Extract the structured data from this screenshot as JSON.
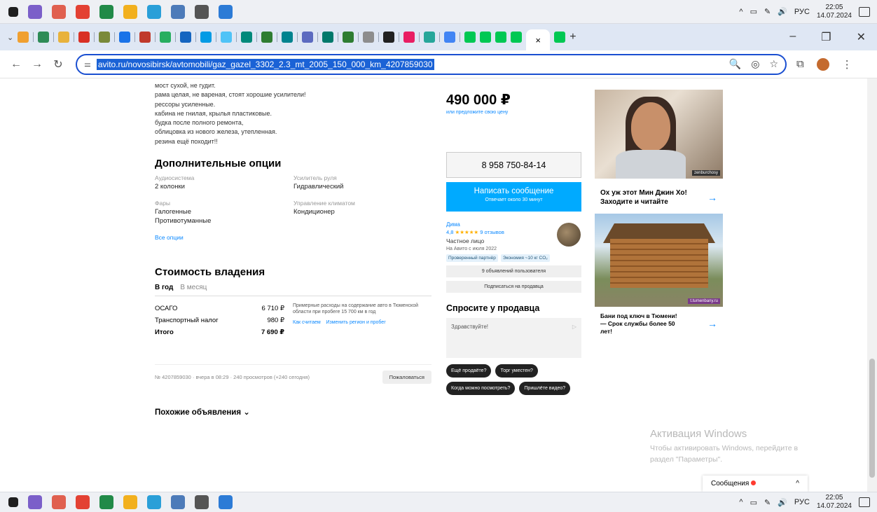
{
  "taskbar": {
    "icons": [
      {
        "name": "start-icon",
        "color": "#1f1f1f"
      },
      {
        "name": "viber-icon",
        "color": "#7b5fc9"
      },
      {
        "name": "paint-icon",
        "color": "#e0604f"
      },
      {
        "name": "chrome-icon",
        "color": "#e34133"
      },
      {
        "name": "excel-icon",
        "color": "#218a48"
      },
      {
        "name": "folder-icon",
        "color": "#f2b01e"
      },
      {
        "name": "telegram-icon",
        "color": "#2a9fd8"
      },
      {
        "name": "notepad-icon",
        "color": "#4d7bb9"
      },
      {
        "name": "settings-icon",
        "color": "#555555"
      },
      {
        "name": "photos-icon",
        "color": "#2c7bd6"
      }
    ],
    "lang": "РУС",
    "time": "22:05",
    "date": "14.07.2024"
  },
  "browser": {
    "active_tab_close": "×",
    "new_tab": "+",
    "url": "avito.ru/novosibirsk/avtomobili/gaz_gazel_3302_2.3_mt_2005_150_000_km_4207859030"
  },
  "listing": {
    "description_lines": [
      "мост сухой, не гудит.",
      "рама целая, не вареная, стоят хорошие усилители!",
      "рессоры усиленные.",
      "кабина не гнилая, крылья пластиковые.",
      "будка после полного ремонта,",
      "облицовка из нового железа, утепленная.",
      "резина ещё походит!!"
    ],
    "options_title": "Дополнительные опции",
    "options": [
      {
        "label": "Аудиосистема",
        "values": [
          "2 колонки"
        ]
      },
      {
        "label": "Усилитель руля",
        "values": [
          "Гидравлический"
        ]
      },
      {
        "label": "Фары",
        "values": [
          "Галогенные",
          "Противотуманные"
        ]
      },
      {
        "label": "Управление климатом",
        "values": [
          "Кондиционер"
        ]
      }
    ],
    "all_options_link": "Все опции",
    "ownership_title": "Стоимость владения",
    "ownership_tabs": [
      "В год",
      "В месяц"
    ],
    "ownership_rows": [
      {
        "name": "ОСАГО",
        "value": "6 710 ₽"
      },
      {
        "name": "Транспортный налог",
        "value": "980 ₽"
      },
      {
        "name": "Итого",
        "value": "7 690 ₽"
      }
    ],
    "ownership_note": "Примерные расходы на содержание авто в Тюменской области при пробеге 15 700 км в год",
    "ownership_links": [
      "Как считаем",
      "Изменить регион и пробег"
    ],
    "meta": "№ 4207859030 · вчера в 08:29 · 240 просмотров (+240 сегодня)",
    "complain": "Пожаловаться",
    "similar": "Похожие объявления ⌄"
  },
  "sidebar": {
    "price": "490 000 ₽",
    "price_sub": "или предложите свою цену",
    "phone": "8 958 750-84-14",
    "message_btn": "Написать сообщение",
    "message_sub": "Отвечает около 30 минут",
    "seller_name": "Дима",
    "seller_rating": "4,8",
    "seller_stars": "★★★★★",
    "seller_reviews": "9 отзывов",
    "seller_type": "Частное лицо",
    "seller_since": "На Авито с июля 2022",
    "badges": [
      "Проверенный партнёр",
      "Экономия ~10 кг CO₂"
    ],
    "listings_btn": "9 объявлений пользователя",
    "subscribe_btn": "Подписаться на продавца",
    "ask_title": "Спросите у продавца",
    "ask_placeholder": "Здравствуйте!",
    "ask_send": "▷",
    "chips": [
      "Ещё продаёте?",
      "Торг уместен?",
      "Когда можно посмотреть?",
      "Пришлёте видео?"
    ]
  },
  "ads": [
    {
      "text": "Ох уж этот Мин Джин Хо! Заходите и читайте",
      "arrow": "→",
      "tag": "zenburchosy"
    },
    {
      "text": "Бани под ключ в Тюмени! — Срок службы более 50 лет!",
      "arrow": "→",
      "tag": "t.tumenbany.ru"
    }
  ],
  "watermark": {
    "title": "Активация Windows",
    "line1": "Чтобы активировать Windows, перейдите в",
    "line2": "раздел \"Параметры\"."
  },
  "messages": {
    "label": "Сообщения",
    "chevron": "^"
  }
}
